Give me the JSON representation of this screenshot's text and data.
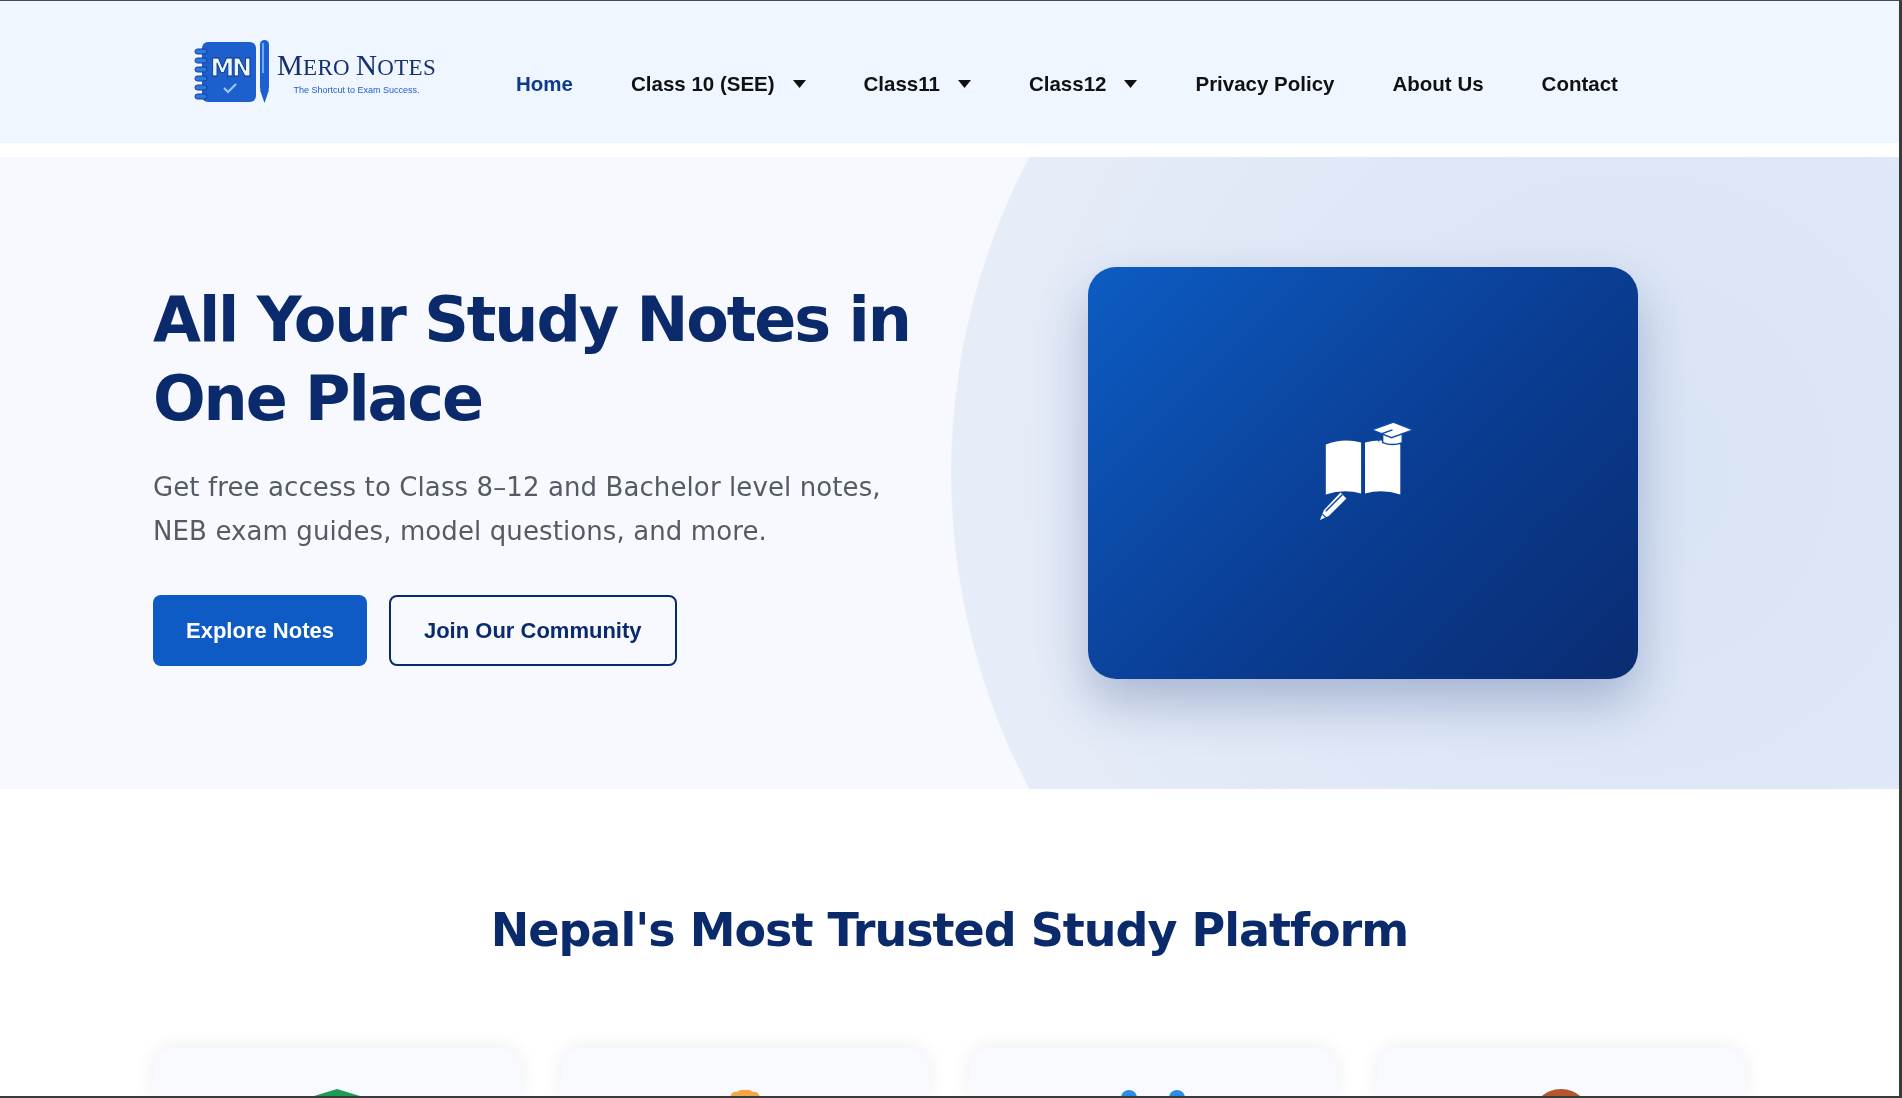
{
  "header": {
    "brand": {
      "monogram": "MN",
      "name": "MERO NOTES",
      "tagline": "The Shortcut to Exam Success."
    },
    "nav": [
      {
        "label": "Home",
        "selected": true,
        "dropdown": false
      },
      {
        "label": "Class 10 (SEE)",
        "selected": false,
        "dropdown": true
      },
      {
        "label": "Class11",
        "selected": false,
        "dropdown": true
      },
      {
        "label": "Class12",
        "selected": false,
        "dropdown": true
      },
      {
        "label": "Privacy Policy",
        "selected": false,
        "dropdown": false
      },
      {
        "label": "About Us",
        "selected": false,
        "dropdown": false
      },
      {
        "label": "Contact",
        "selected": false,
        "dropdown": false
      }
    ]
  },
  "hero": {
    "heading": "All Your Study Notes in One Place",
    "text": "Get free access to Class 8–12 and Bachelor level notes, NEB exam guides, model questions, and more.",
    "buttons": [
      {
        "label": "Explore Notes",
        "kind": "primary"
      },
      {
        "label": "Join Our Community",
        "kind": "outline"
      }
    ]
  },
  "trust": {
    "heading": "Nepal's Most Trusted Study Platform",
    "cards": [
      {
        "kind": "cap",
        "color": "#1f9d55"
      },
      {
        "kind": "award",
        "color": "#f4a640"
      },
      {
        "kind": "users",
        "color": "#2e8ce6"
      },
      {
        "kind": "circle",
        "color": "#b4562e"
      }
    ]
  }
}
